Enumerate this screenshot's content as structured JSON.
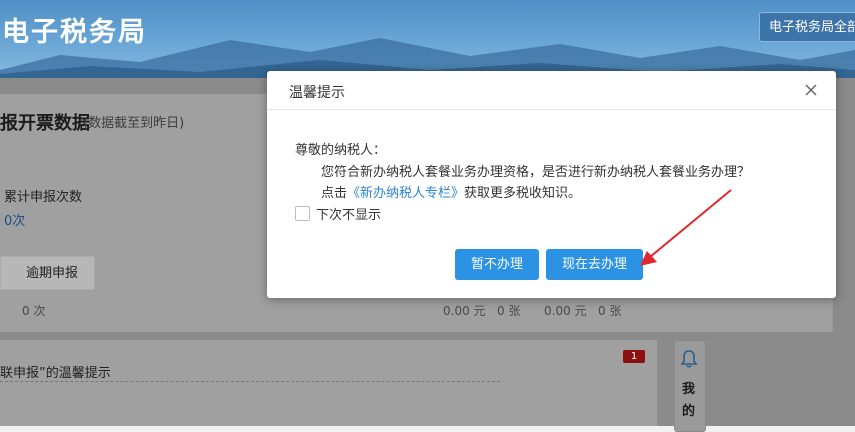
{
  "header": {
    "app_title": "电子税务局",
    "top_button": "电子税务局全部"
  },
  "background": {
    "section_title": "报开票数据",
    "section_subtitle": "(数据截至到昨日)",
    "cumulative_label": "累计申报次数",
    "cumulative_value": "0次",
    "overdue_tab": "逾期申报",
    "overdue_count": "0 次",
    "amount_1": "0.00 元",
    "count_1": "0 张",
    "amount_2": "0.00 元",
    "count_2": "0 张",
    "tip_title": "联申报”的温馨提示",
    "badge_count": "1",
    "side_panel_text": "我的"
  },
  "modal": {
    "title": "温馨提示",
    "greeting": "尊敬的纳税人：",
    "line1": "您符合新办纳税人套餐业务办理资格，是否进行新办纳税人套餐业务办理？",
    "line2_prefix": "点击",
    "line2_link": "《新办纳税人专栏》",
    "line2_suffix": "获取更多税收知识。",
    "checkbox_label": "下次不显示",
    "checkbox_checked": false,
    "btn_later": "暂不办理",
    "btn_now": "现在去办理"
  },
  "colors": {
    "primary_button": "#2c92e4",
    "link": "#2b84d4",
    "annotation_arrow": "#e0282e"
  }
}
